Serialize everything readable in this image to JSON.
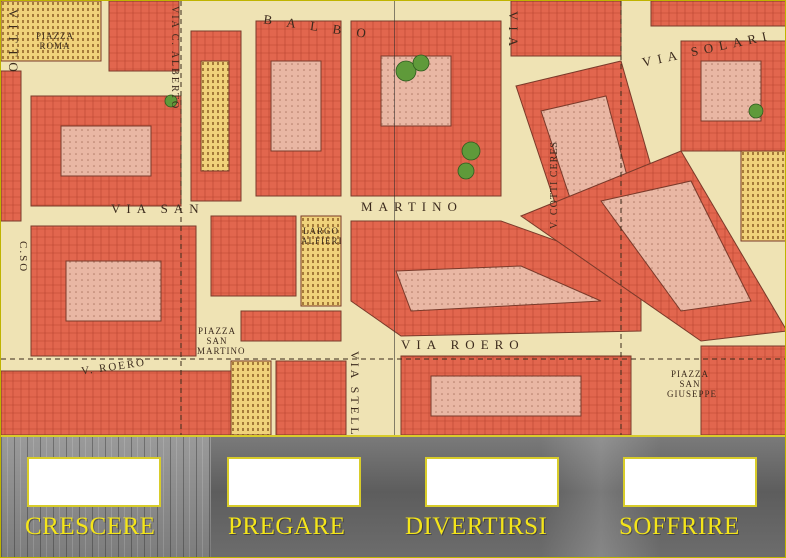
{
  "map": {
    "labels": {
      "vittorio": "VITTO",
      "piazza_roma": "PIAZZA ROMA",
      "via_carlo_alberto": "VIA C. ALBERTO",
      "balbo": "B A L B O",
      "via_bogino": "VIA",
      "via_solari": "VIA SOLARI",
      "via_san_martino": "VIA SAN",
      "martino": "MARTINO",
      "corso": "C.SO",
      "largo_alfieri": "LARGO ALFIERI",
      "via_cotti_ceres": "V. COTTI CERES",
      "piazza_san_martino": "PIAZZA SAN MARTINO",
      "via_roero_left": "V. ROERO",
      "via_roero": "VIA ROERO",
      "via_stella": "VIA STELLA",
      "piazza_san_giuseppe": "PIAZZA SAN GIUSEPPE"
    }
  },
  "cards": [
    {
      "word": "CRESCERE",
      "drop_placeholder": ""
    },
    {
      "word": "PREGARE",
      "drop_placeholder": ""
    },
    {
      "word": "DIVERTIRSI",
      "drop_placeholder": ""
    },
    {
      "word": "SOFFRIRE",
      "drop_placeholder": ""
    }
  ],
  "colors": {
    "accent": "#f4e51a",
    "border": "#d8cc2a",
    "roof": "#e0624d",
    "street": "#efe3b4"
  }
}
